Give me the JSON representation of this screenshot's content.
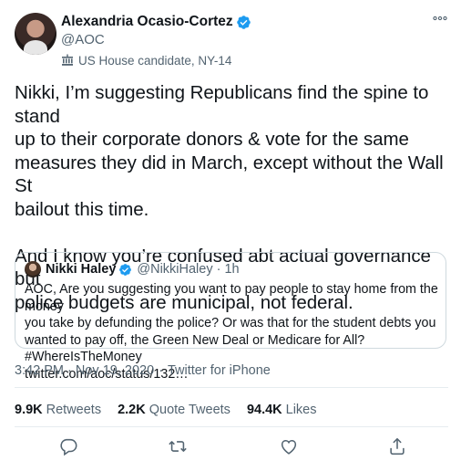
{
  "author": {
    "name": "Alexandria Ocasio-Cortez",
    "handle": "@AOC",
    "label": "US House candidate, NY-14"
  },
  "tweet": {
    "text": "Nikki, I’m suggesting Republicans find the spine to stand\nup to their corporate donors & vote for the same\nmeasures they did in March, except without the Wall St\nbailout this time.\n\nAnd I know you’re confused abt actual governance but\npolice budgets are municipal, not federal.",
    "timestamp": "3:42 PM · Nov 19, 2020",
    "source": "Twitter for iPhone"
  },
  "quoted": {
    "name": "Nikki Haley",
    "handle": "@NikkiHaley",
    "dot": "·",
    "time": "1h",
    "text": "AOC, Are you suggesting you want to pay people to stay home from the money\nyou take by defunding the police? Or was that for the student debts you\nwanted to pay off, the Green New Deal or Medicare for All? #WhereIsTheMoney\ntwitter.com/aoc/status/132…"
  },
  "stats": {
    "retweets_count": "9.9K",
    "retweets_label": "Retweets",
    "quote_count": "2.2K",
    "quote_label": "Quote Tweets",
    "likes_count": "94.4K",
    "likes_label": "Likes"
  },
  "meta": {
    "separator": "·"
  },
  "colors": {
    "accent": "#1d9bf0",
    "secondary_text": "#536471",
    "primary_text": "#0f1419",
    "border": "#cfd9de"
  },
  "icons": {
    "verified": "verified-badge-icon",
    "label": "government-building-icon",
    "more": "more-horizontal-icon",
    "reply": "reply-icon",
    "retweet": "retweet-icon",
    "like": "heart-icon",
    "share": "share-icon"
  }
}
